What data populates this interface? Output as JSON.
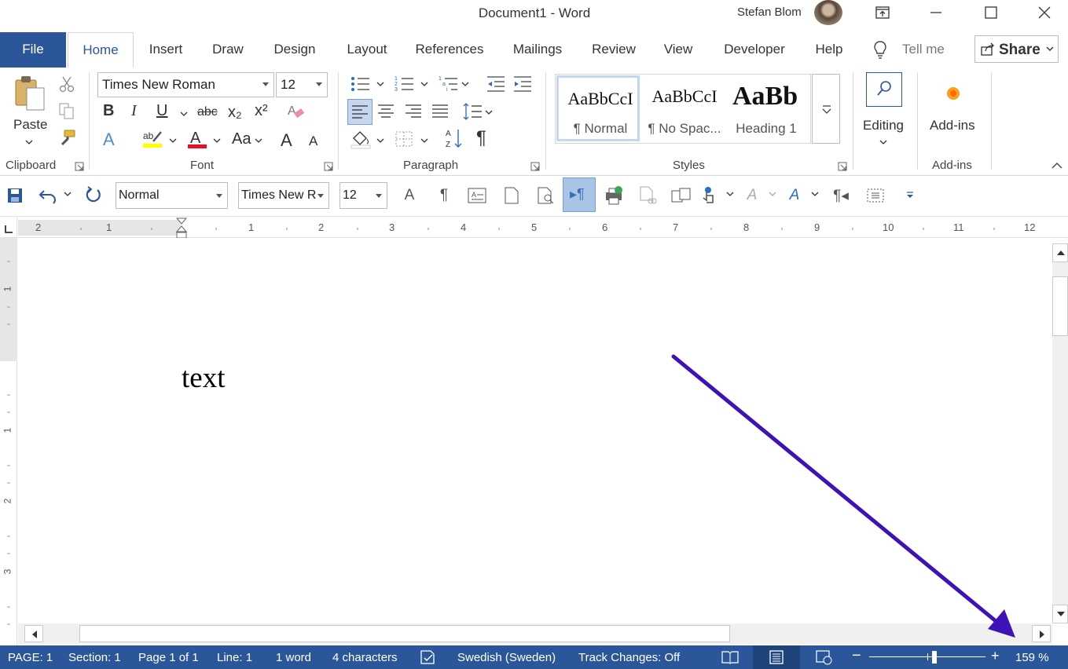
{
  "window": {
    "title": "Document1  -  Word",
    "user": "Stefan Blom"
  },
  "tabs": [
    "File",
    "Home",
    "Insert",
    "Draw",
    "Design",
    "Layout",
    "References",
    "Mailings",
    "Review",
    "View",
    "Developer",
    "Help"
  ],
  "tellme": "Tell me",
  "share": "Share",
  "clipboard": {
    "paste": "Paste",
    "group": "Clipboard"
  },
  "font": {
    "name": "Times New Roman",
    "size": "12",
    "group": "Font",
    "bold": "B",
    "italic": "I",
    "underline": "U",
    "strike": "abc",
    "sub": "x₂",
    "sup": "x²",
    "case": "Aa",
    "grow": "A",
    "shrink": "A",
    "effects": "A",
    "highlight_color": "#ffff00",
    "font_color": "#e81123"
  },
  "paragraph": {
    "group": "Paragraph",
    "marks": "¶"
  },
  "styles": {
    "group": "Styles",
    "items": [
      {
        "preview": "AaBbCcI",
        "name": "¶ Normal"
      },
      {
        "preview": "AaBbCcI",
        "name": "¶ No Spac..."
      },
      {
        "preview": "AaBb",
        "name": "Heading 1"
      }
    ]
  },
  "editing": {
    "label": "Editing"
  },
  "addins": {
    "label": "Add-ins",
    "group": "Add-ins"
  },
  "qat": {
    "style": "Normal",
    "font": "Times New R",
    "size": "12"
  },
  "ruler": {
    "h": [
      "2",
      "1",
      "1",
      "2",
      "3",
      "4",
      "5",
      "6",
      "7",
      "8",
      "9",
      "10",
      "11",
      "12"
    ],
    "v": [
      "1",
      "1",
      "2",
      "3"
    ]
  },
  "document": {
    "text": "text"
  },
  "status": {
    "page": "PAGE: 1",
    "section": "Section: 1",
    "pageof": "Page 1 of 1",
    "line": "Line: 1",
    "words": "1 word",
    "chars": "4 characters",
    "lang": "Swedish (Sweden)",
    "track": "Track Changes: Off",
    "zoom": "159 %",
    "zoom_level": 0.56
  },
  "annotation": {
    "arrow_color": "#3d13b8"
  },
  "colors": {
    "brand": "#2b579a"
  }
}
